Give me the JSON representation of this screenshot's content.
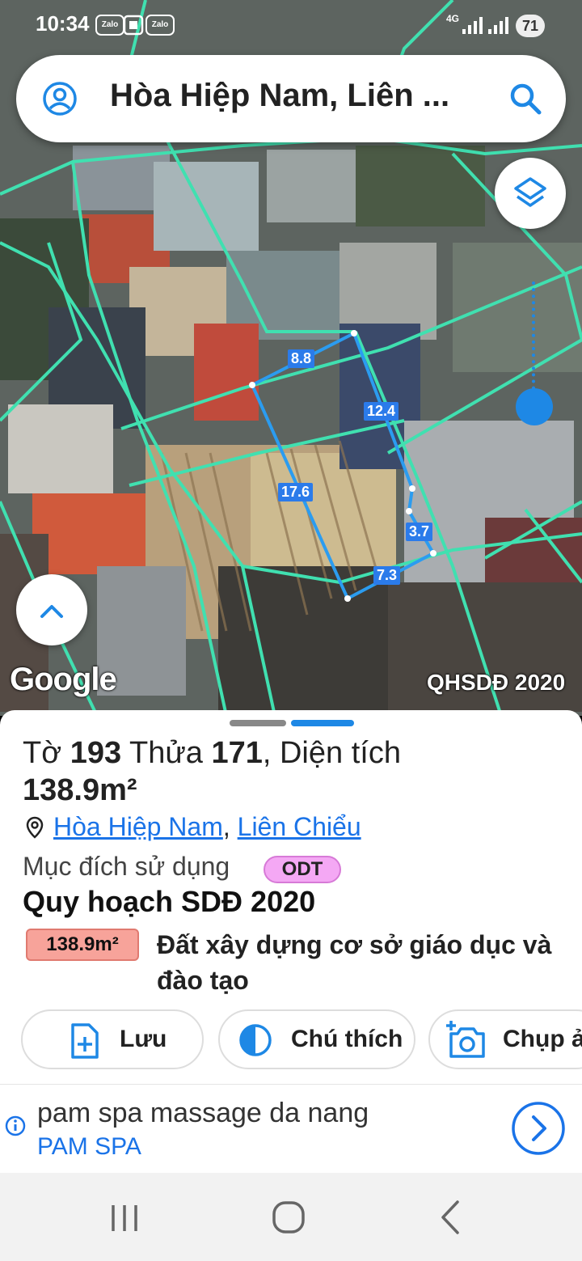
{
  "status_bar": {
    "time": "10:34",
    "app_badges": [
      "Zalo",
      "Zalo"
    ],
    "network": "4G",
    "battery": "71"
  },
  "search": {
    "text": "Hòa Hiệp Nam, Liên ...",
    "left_icon": "account-icon",
    "right_icon": "search-icon"
  },
  "map": {
    "layers_icon": "layers-icon",
    "expand_icon": "chevron-up-icon",
    "logo": "Google",
    "credit": "QHSDĐ 2020",
    "dimensions": [
      "8.8",
      "12.4",
      "17.6",
      "3.7",
      "7.3"
    ],
    "parcel_line_color": "#2b9cf0",
    "boundary_color": "#40e0b0"
  },
  "parcel": {
    "sheet_label": "Tờ ",
    "sheet_no": "193",
    "plot_label": " Thửa ",
    "plot_no": "171",
    "area_label": ", Diện tích",
    "area": "138.9m²",
    "ward": "Hòa Hiệp Nam",
    "separator": ",",
    "district": "Liên Chiểu",
    "usage_label": "Mục đích sử dụng",
    "usage_code": "ODT",
    "plan_title": "Quy hoạch SDĐ 2020",
    "plan_area": "138.9m²",
    "plan_land_type": "Đất xây dựng cơ sở giáo dục và đào tạo"
  },
  "actions": {
    "save": "Lưu",
    "legend": "Chú thích",
    "photo": "Chụp ả"
  },
  "ad": {
    "title": "pam spa massage da nang",
    "subtitle": "PAM SPA"
  },
  "nav": {
    "recent_icon": "recent-apps-icon",
    "home_icon": "home-icon",
    "back_icon": "back-icon"
  }
}
